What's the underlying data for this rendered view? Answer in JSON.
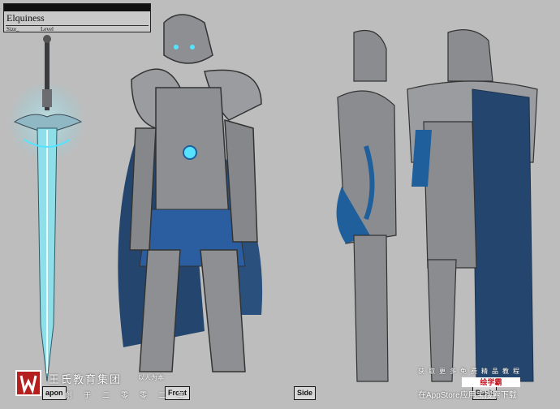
{
  "title_block": {
    "name": "Elquiness",
    "size_label": "Size_",
    "level_label": "Level"
  },
  "view_labels": {
    "weapon": "apon",
    "front": "Front",
    "side": "Side",
    "back": "Back"
  },
  "watermark_left": {
    "org": "王氏教育集团",
    "slogan": "以人为本",
    "date": "创于二零零二年"
  },
  "watermark_right": {
    "line1": "获取更多免费精品教程",
    "badge": "绘学霸",
    "line3": "在AppStore应用宝搜索下载"
  },
  "colors": {
    "background": "#bdbdbd",
    "armor": "#8d8f92",
    "armor_dark": "#4c4e52",
    "cape_blue": "#1f5f9c",
    "glow_cyan": "#56e3ff"
  }
}
